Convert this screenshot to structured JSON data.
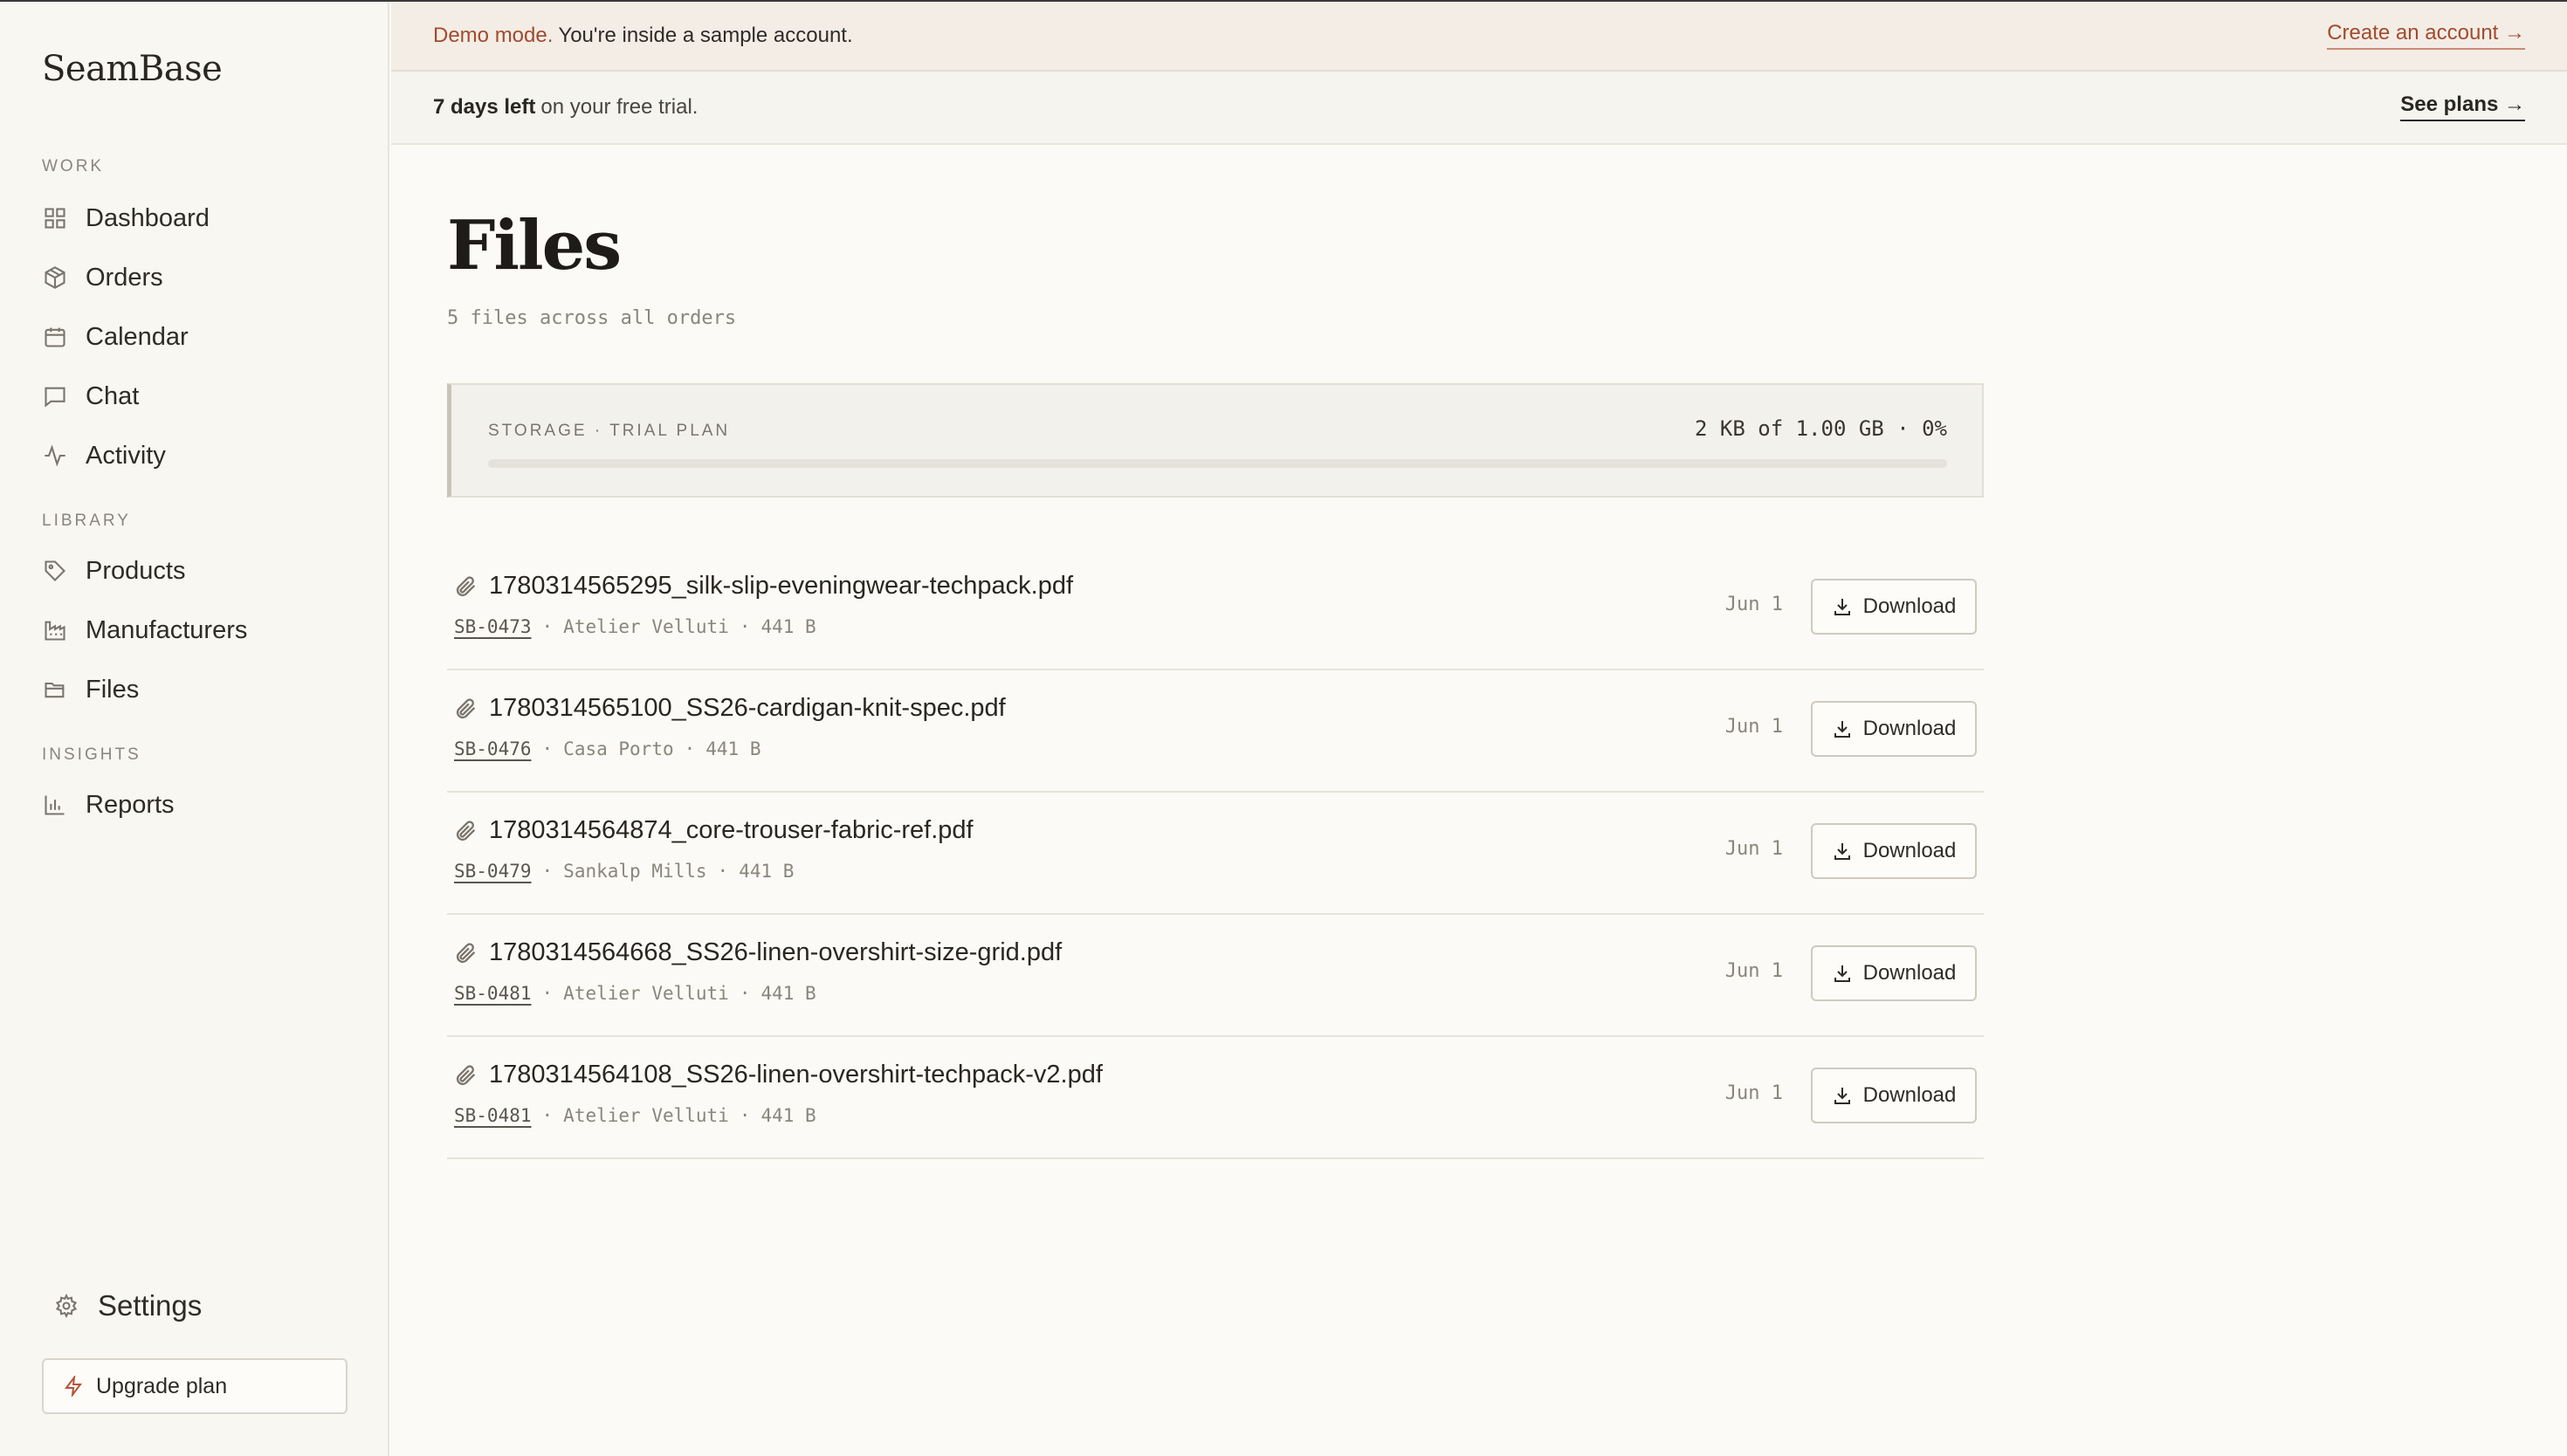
{
  "brand": "SeamBase",
  "sidebar": {
    "sections": [
      {
        "label": "WORK",
        "items": [
          {
            "label": "Dashboard",
            "icon": "grid-icon"
          },
          {
            "label": "Orders",
            "icon": "box-icon"
          },
          {
            "label": "Calendar",
            "icon": "calendar-icon"
          },
          {
            "label": "Chat",
            "icon": "chat-icon"
          },
          {
            "label": "Activity",
            "icon": "activity-icon"
          }
        ]
      },
      {
        "label": "LIBRARY",
        "items": [
          {
            "label": "Products",
            "icon": "tag-icon"
          },
          {
            "label": "Manufacturers",
            "icon": "factory-icon"
          },
          {
            "label": "Files",
            "icon": "folder-icon"
          }
        ]
      },
      {
        "label": "INSIGHTS",
        "items": [
          {
            "label": "Reports",
            "icon": "bar-chart-icon"
          }
        ]
      }
    ],
    "settings_label": "Settings",
    "upgrade_label": "Upgrade plan"
  },
  "banner_demo": {
    "tag": "Demo mode.",
    "message": "You're inside a sample account.",
    "cta": "Create an account →"
  },
  "banner_trial": {
    "days": "7 days left",
    "message": "on your free trial.",
    "cta": "See plans →"
  },
  "page": {
    "title": "Files",
    "subtitle": "5 files across all orders"
  },
  "storage": {
    "label": "STORAGE · TRIAL PLAN",
    "usage": "2 KB of 1.00 GB · 0%",
    "fraction_used": 0.0
  },
  "files": [
    {
      "name": "1780314565295_silk-slip-eveningwear-techpack.pdf",
      "order": "SB-0473",
      "manufacturer": "Atelier Velluti",
      "size": "441 B",
      "date": "Jun 1",
      "action": "Download"
    },
    {
      "name": "1780314565100_SS26-cardigan-knit-spec.pdf",
      "order": "SB-0476",
      "manufacturer": "Casa Porto",
      "size": "441 B",
      "date": "Jun 1",
      "action": "Download"
    },
    {
      "name": "1780314564874_core-trouser-fabric-ref.pdf",
      "order": "SB-0479",
      "manufacturer": "Sankalp Mills",
      "size": "441 B",
      "date": "Jun 1",
      "action": "Download"
    },
    {
      "name": "1780314564668_SS26-linen-overshirt-size-grid.pdf",
      "order": "SB-0481",
      "manufacturer": "Atelier Velluti",
      "size": "441 B",
      "date": "Jun 1",
      "action": "Download"
    },
    {
      "name": "1780314564108_SS26-linen-overshirt-techpack-v2.pdf",
      "order": "SB-0481",
      "manufacturer": "Atelier Velluti",
      "size": "441 B",
      "date": "Jun 1",
      "action": "Download"
    }
  ],
  "colors": {
    "accent": "#a44a2c",
    "background": "#fbfaf6",
    "sidebar": "#f8f7f2"
  }
}
